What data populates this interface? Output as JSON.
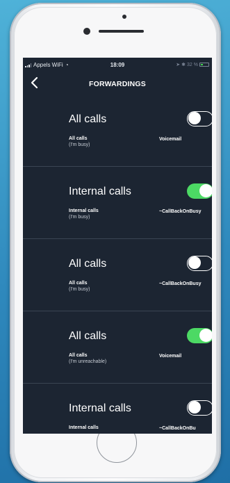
{
  "status": {
    "carrier": "Appels WiFi",
    "time": "18:09",
    "battery": "32 %",
    "battery_level": 0.32
  },
  "nav": {
    "title": "FORWARDINGS"
  },
  "forwardings": [
    {
      "title": "All calls",
      "sub1": "All calls",
      "sub2": "(I'm busy)",
      "destination": "Voicemail",
      "enabled": false
    },
    {
      "title": "Internal calls",
      "sub1": "Internal calls",
      "sub2": "(I'm busy)",
      "destination": "~CallBackOnBusy",
      "enabled": true
    },
    {
      "title": "All calls",
      "sub1": "All calls",
      "sub2": "(I'm busy)",
      "destination": "~CallBackOnBusy",
      "enabled": false
    },
    {
      "title": "All calls",
      "sub1": "All calls",
      "sub2": "(I'm unreachable)",
      "destination": "Voicemail",
      "enabled": true
    },
    {
      "title": "Internal calls",
      "sub1": "Internal calls",
      "sub2": "",
      "destination": "~CallBackOnBu",
      "enabled": false
    }
  ],
  "colors": {
    "screen_bg": "#1c2532",
    "toggle_on": "#4cd964",
    "separator": "#3a4553"
  }
}
